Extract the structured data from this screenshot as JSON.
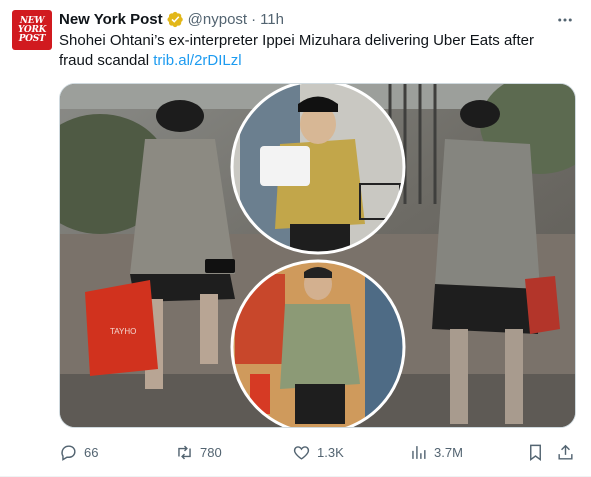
{
  "account": {
    "avatar_text": [
      "NEW",
      "YORK",
      "POST"
    ],
    "display_name": "New York Post",
    "handle": "@nypost",
    "separator": "·",
    "time": "11h"
  },
  "tweet": {
    "text": "Shohei Ohtani’s ex-interpreter Ippei Mizuhara delivering Uber Eats after fraud scandal",
    "link": "trib.al/2rDILzl"
  },
  "media": {
    "bag_text": "TAYHO"
  },
  "actions": {
    "replies": "66",
    "reposts": "780",
    "likes": "1.3K",
    "views": "3.7M"
  },
  "icons": {
    "verified": "verified-badge-icon",
    "more": "more-dots-icon",
    "reply": "reply-icon",
    "repost": "repost-icon",
    "like": "heart-icon",
    "views": "views-chart-icon",
    "bookmark": "bookmark-icon",
    "share": "share-icon"
  },
  "colors": {
    "brand_red": "#d11a1f",
    "link_blue": "#1d9bf0",
    "verified_gold": "#e2b719",
    "secondary_text": "#536471"
  }
}
